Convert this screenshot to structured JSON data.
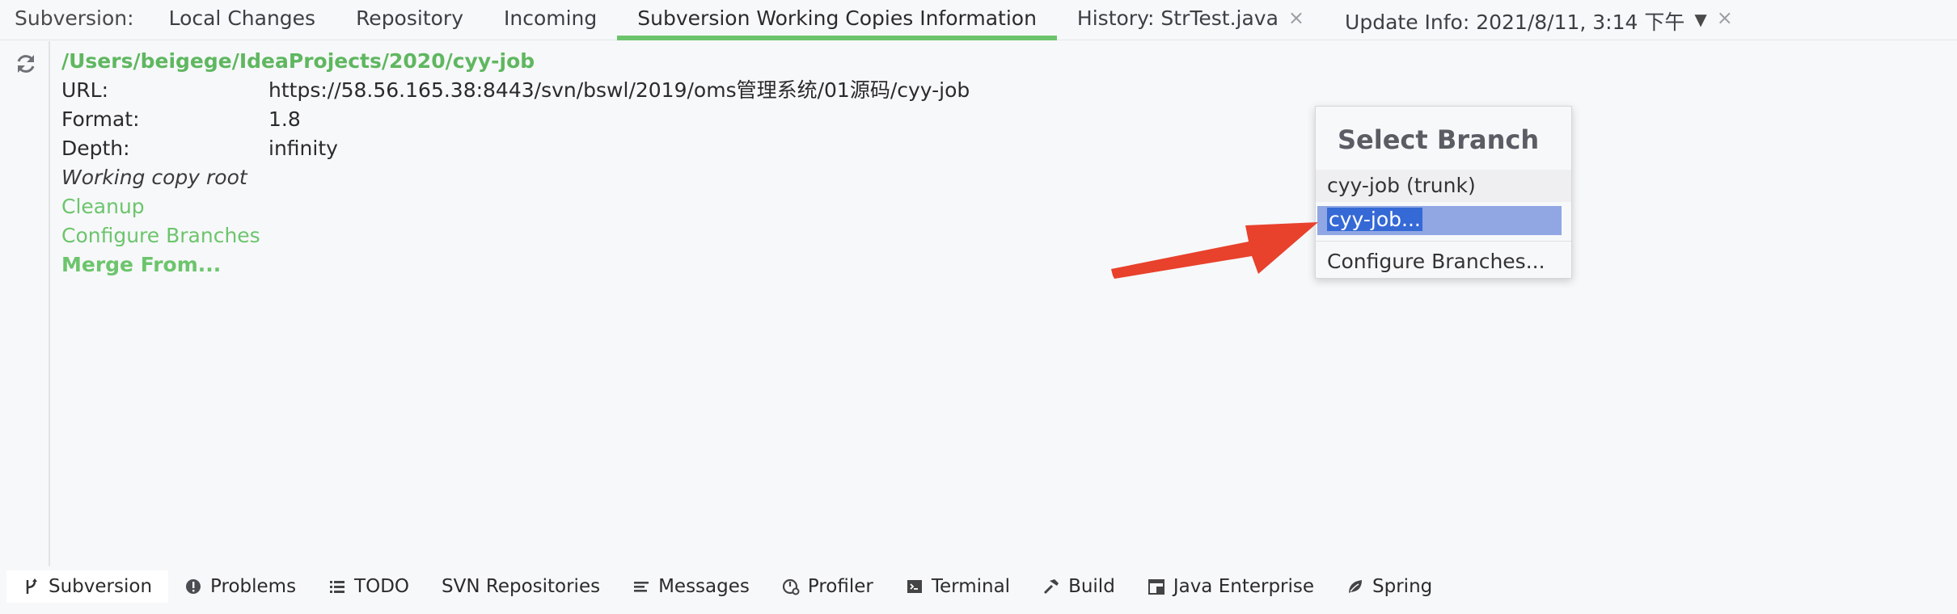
{
  "tabbar": {
    "prefix": "Subversion:",
    "tabs": [
      {
        "label": "Local Changes"
      },
      {
        "label": "Repository"
      },
      {
        "label": "Incoming"
      },
      {
        "label": "Subversion Working Copies Information"
      },
      {
        "label": "History: StrTest.java"
      },
      {
        "label": "Update Info: 2021/8/11, 3:14 下午"
      }
    ],
    "close_glyph": "×"
  },
  "info": {
    "path": "/Users/beigege/IdeaProjects/2020/cyy-job",
    "url_label": "URL:",
    "url_value": "https://58.56.165.38:8443/svn/bswl/2019/oms管理系统/01源码/cyy-job",
    "format_label": "Format:",
    "format_value": "1.8",
    "depth_label": "Depth:",
    "depth_value": "infinity",
    "working_copy_root": "Working copy root",
    "cleanup": "Cleanup",
    "configure_branches": "Configure Branches",
    "merge_from": "Merge From..."
  },
  "popup": {
    "title": "Select Branch",
    "items": [
      {
        "label": "cyy-job (trunk)"
      },
      {
        "label": "cyy-job..."
      },
      {
        "label": "Configure Branches..."
      }
    ]
  },
  "bottombar": {
    "tabs": [
      {
        "label": "Subversion",
        "icon": "branch-icon"
      },
      {
        "label": "Problems",
        "icon": "problems-icon"
      },
      {
        "label": "TODO",
        "icon": "todo-icon"
      },
      {
        "label": "SVN Repositories",
        "icon": ""
      },
      {
        "label": "Messages",
        "icon": "messages-icon"
      },
      {
        "label": "Profiler",
        "icon": "profiler-icon"
      },
      {
        "label": "Terminal",
        "icon": "terminal-icon"
      },
      {
        "label": "Build",
        "icon": "build-icon"
      },
      {
        "label": "Java Enterprise",
        "icon": "java-enterprise-icon"
      },
      {
        "label": "Spring",
        "icon": "spring-icon"
      }
    ]
  },
  "colors": {
    "accent_green": "#6cc56c",
    "selection_blue": "#3569d6",
    "arrow_red": "#e8412c"
  }
}
